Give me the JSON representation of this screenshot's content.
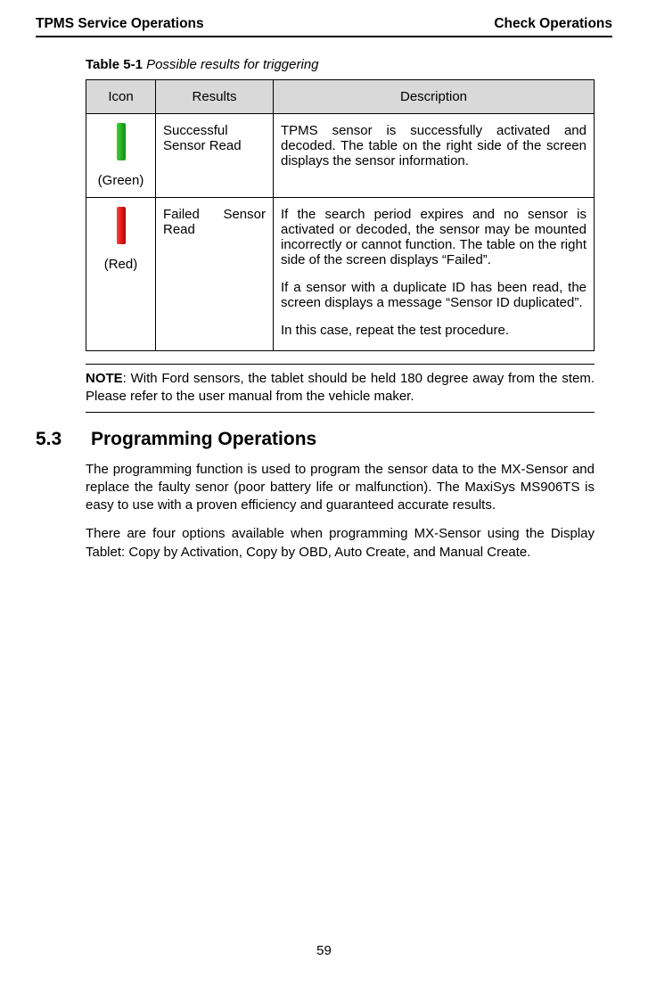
{
  "header": {
    "left": "TPMS Service Operations",
    "right": "Check Operations"
  },
  "table": {
    "caption_label": "Table 5-1",
    "caption_text": " Possible results for triggering",
    "headers": {
      "icon": "Icon",
      "results": "Results",
      "description": "Description"
    },
    "rows": {
      "green": {
        "icon_label": "(Green)",
        "result": "Successful Sensor Read",
        "desc": "TPMS sensor is successfully activated and decoded. The table on the right side of the screen displays the sensor information."
      },
      "red": {
        "icon_label": "(Red)",
        "result": "Failed Sensor Read",
        "desc_p1": "If the search period expires and no sensor is activated or decoded, the sensor may be mounted incorrectly or cannot function. The table on the right side of the screen displays “Failed”.",
        "desc_p2": "If a sensor with a duplicate ID has been read, the screen displays a message “Sensor ID duplicated”.",
        "desc_p3": "In this case, repeat the test procedure."
      }
    }
  },
  "note": {
    "label": "NOTE",
    "text": ": With Ford sensors, the tablet should be held 180 degree away from the stem. Please refer to the user manual from the vehicle maker."
  },
  "section": {
    "number": "5.3",
    "title": "Programming Operations",
    "para1": "The programming function is used to program the sensor data to the MX-Sensor and replace the faulty senor (poor battery life or malfunction). The MaxiSys MS906TS is easy to use with a proven efficiency and guaranteed accurate results.",
    "para2": "There are four options available when programming MX-Sensor using the Display Tablet: Copy by Activation, Copy by OBD, Auto Create, and Manual Create."
  },
  "page_number": "59"
}
